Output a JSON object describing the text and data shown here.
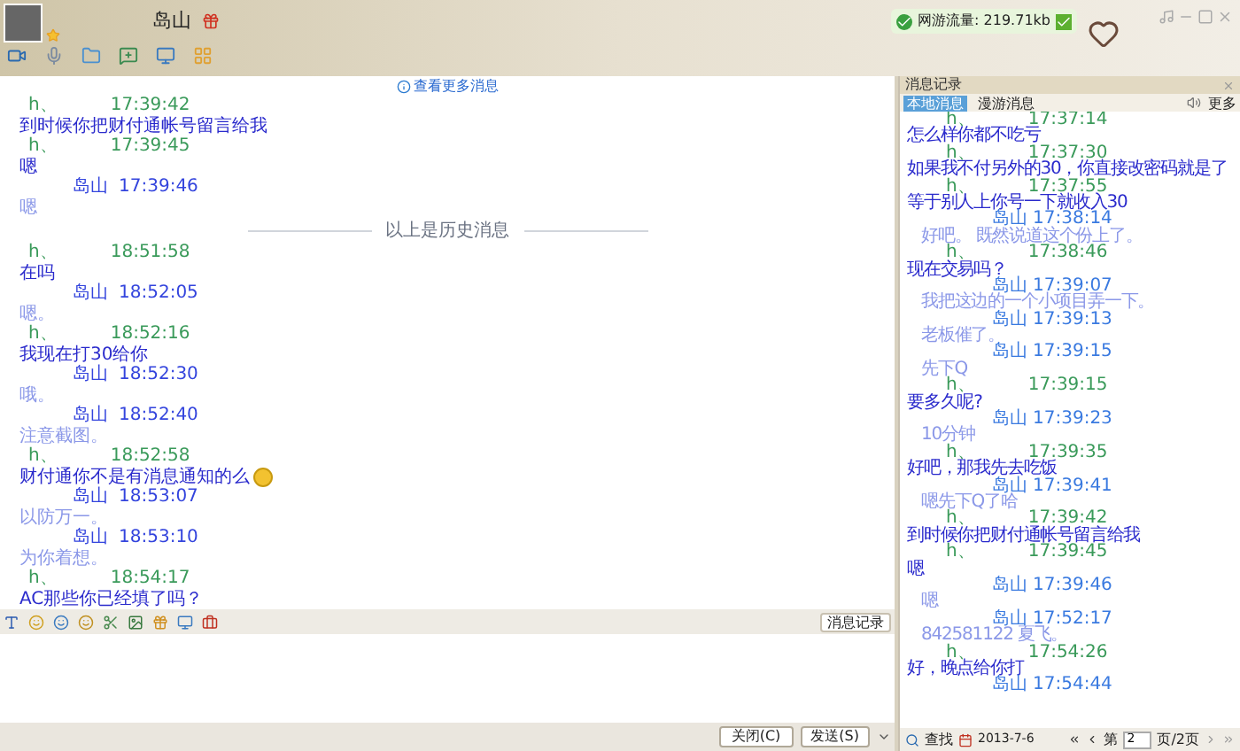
{
  "header": {
    "name": "岛山",
    "traffic": "网游流量: 219.71kb"
  },
  "chat": {
    "more_link": "查看更多消息",
    "divider": "以上是历史消息",
    "messages": [
      {
        "kind": "them",
        "sender": "h、",
        "time": "17:39:42",
        "text": "到时候你把财付通帐号留言给我",
        "emoji": false
      },
      {
        "kind": "them",
        "sender": "h、",
        "time": "17:39:45",
        "text": "嗯",
        "emoji": false
      },
      {
        "kind": "me",
        "sender": "岛山",
        "time": "17:39:46",
        "text": "嗯",
        "emoji": false
      },
      {
        "kind": "divider"
      },
      {
        "kind": "them",
        "sender": "h、",
        "time": "18:51:58",
        "text": "在吗",
        "emoji": false
      },
      {
        "kind": "me",
        "sender": "岛山",
        "time": "18:52:05",
        "text": "嗯。",
        "emoji": false
      },
      {
        "kind": "them",
        "sender": "h、",
        "time": "18:52:16",
        "text": "我现在打30给你",
        "emoji": false
      },
      {
        "kind": "me",
        "sender": "岛山",
        "time": "18:52:30",
        "text": "哦。",
        "emoji": false
      },
      {
        "kind": "me",
        "sender": "岛山",
        "time": "18:52:40",
        "text": "注意截图。",
        "emoji": false
      },
      {
        "kind": "them",
        "sender": "h、",
        "time": "18:52:58",
        "text": "财付通你不是有消息通知的么",
        "emoji": true
      },
      {
        "kind": "me",
        "sender": "岛山",
        "time": "18:53:07",
        "text": "以防万一。",
        "emoji": false
      },
      {
        "kind": "me",
        "sender": "岛山",
        "time": "18:53:10",
        "text": "为你着想。",
        "emoji": false
      },
      {
        "kind": "them",
        "sender": "h、",
        "time": "18:54:17",
        "text": "AC那些你已经填了吗？",
        "emoji": false
      }
    ]
  },
  "input": {
    "history_button": "消息记录"
  },
  "buttons": {
    "close": "关闭(C)",
    "send": "发送(S)"
  },
  "history": {
    "title": "消息记录",
    "tabs": [
      {
        "label": "本地消息",
        "selected": true
      },
      {
        "label": "漫游消息",
        "selected": false
      }
    ],
    "more": "更多",
    "entries": [
      {
        "kind": "them",
        "sender": "h、",
        "time": "17:37:14",
        "text": "怎么样你都不吃亏"
      },
      {
        "kind": "them",
        "sender": "h、",
        "time": "17:37:30",
        "text": "如果我不付另外的30，你直接改密码就是了"
      },
      {
        "kind": "them",
        "sender": "h、",
        "time": "17:37:55",
        "text": "等于别人上你号一下就收入30"
      },
      {
        "kind": "me",
        "sender": "岛山",
        "time": "17:38:14",
        "text": "好吧。 既然说道这个份上了。"
      },
      {
        "kind": "them",
        "sender": "h、",
        "time": "17:38:46",
        "text": "现在交易吗？"
      },
      {
        "kind": "me",
        "sender": "岛山",
        "time": "17:39:07",
        "text": "我把这边的一个小项目弄一下。"
      },
      {
        "kind": "me",
        "sender": "岛山",
        "time": "17:39:13",
        "text": "老板催了。"
      },
      {
        "kind": "me",
        "sender": "岛山",
        "time": "17:39:15",
        "text": "先下Q"
      },
      {
        "kind": "them",
        "sender": "h、",
        "time": "17:39:15",
        "text": "要多久呢?"
      },
      {
        "kind": "me",
        "sender": "岛山",
        "time": "17:39:23",
        "text": "10分钟"
      },
      {
        "kind": "them",
        "sender": "h、",
        "time": "17:39:35",
        "text": "好吧，那我先去吃饭"
      },
      {
        "kind": "me",
        "sender": "岛山",
        "time": "17:39:41",
        "text": "嗯先下Q了哈"
      },
      {
        "kind": "them",
        "sender": "h、",
        "time": "17:39:42",
        "text": "到时候你把财付通帐号留言给我"
      },
      {
        "kind": "them",
        "sender": "h、",
        "time": "17:39:45",
        "text": "嗯"
      },
      {
        "kind": "me",
        "sender": "岛山",
        "time": "17:39:46",
        "text": "嗯"
      },
      {
        "kind": "me",
        "sender": "岛山",
        "time": "17:52:17",
        "text": "842581122 夏飞。"
      },
      {
        "kind": "them",
        "sender": "h、",
        "time": "17:54:26",
        "text": "好，晚点给你打"
      },
      {
        "kind": "me",
        "sender": "岛山",
        "time": "17:54:44"
      }
    ],
    "footer": {
      "search": "查找",
      "date": "2013-7-6",
      "page_prefix": "第",
      "page": "2",
      "page_suffix": "页/2页"
    }
  }
}
